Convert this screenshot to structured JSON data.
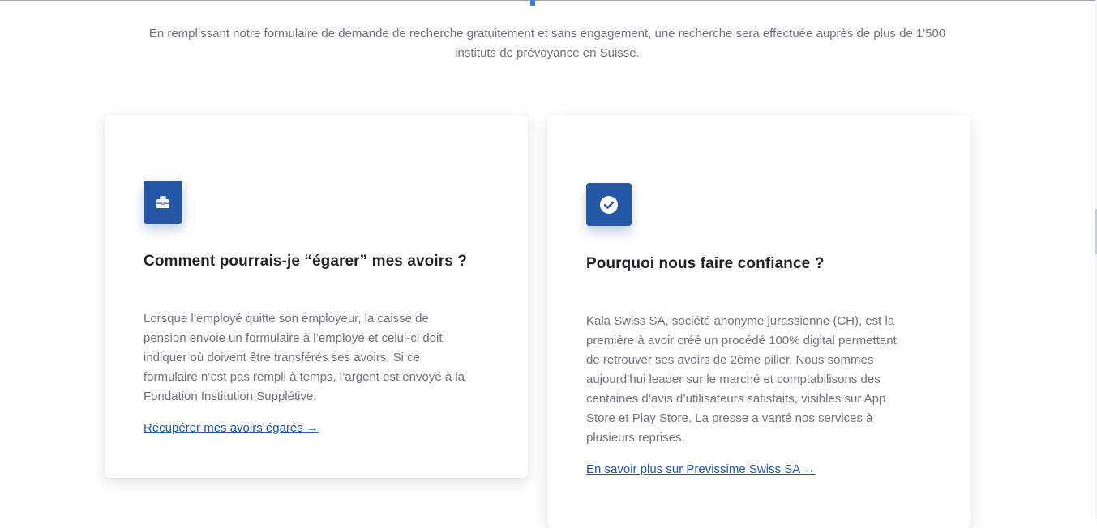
{
  "intro": {
    "line1": "En remplissant notre formulaire de demande de recherche gratuitement et sans engagement, une recherche sera effectuée auprès de plus de 1'500",
    "line2": "instituts de prévoyance en Suisse."
  },
  "cards": [
    {
      "icon": "briefcase-icon",
      "title": "Comment pourrais-je “égarer” mes avoirs ?",
      "lines": [
        "Lorsque l’employé quitte son employeur, la caisse de",
        "pension envoie un formulaire à l’employé et celui-ci doit",
        "indiquer où doivent être transférés ses avoirs. Si ce",
        "formulaire n’est pas rempli à temps, l’argent est envoyé à la",
        "Fondation Institution Supplétive."
      ],
      "link": "Récupérer mes avoirs égarés →"
    },
    {
      "icon": "check-circle-icon",
      "title": "Pourquoi nous faire confiance ?",
      "lines": [
        "Kala Swiss SA, société anonyme jurassienne (CH), est la",
        "première à avoir créé un procédé 100% digital permettant",
        "de retrouver ses avoirs de 2ème pilier. Nous sommes",
        "aujourd’hui leader sur le marché et comptabilisons des",
        "centaines d’avis d’utilisateurs satisfaits, visibles sur App",
        "Store et Play Store. La presse a vanté nos services à",
        "plusieurs reprises."
      ],
      "link": "En savoir plus sur Previssime Swiss SA →"
    }
  ],
  "colors": {
    "accent": "#2458a6",
    "text_muted": "#6b7480",
    "heading": "#1f2328"
  }
}
